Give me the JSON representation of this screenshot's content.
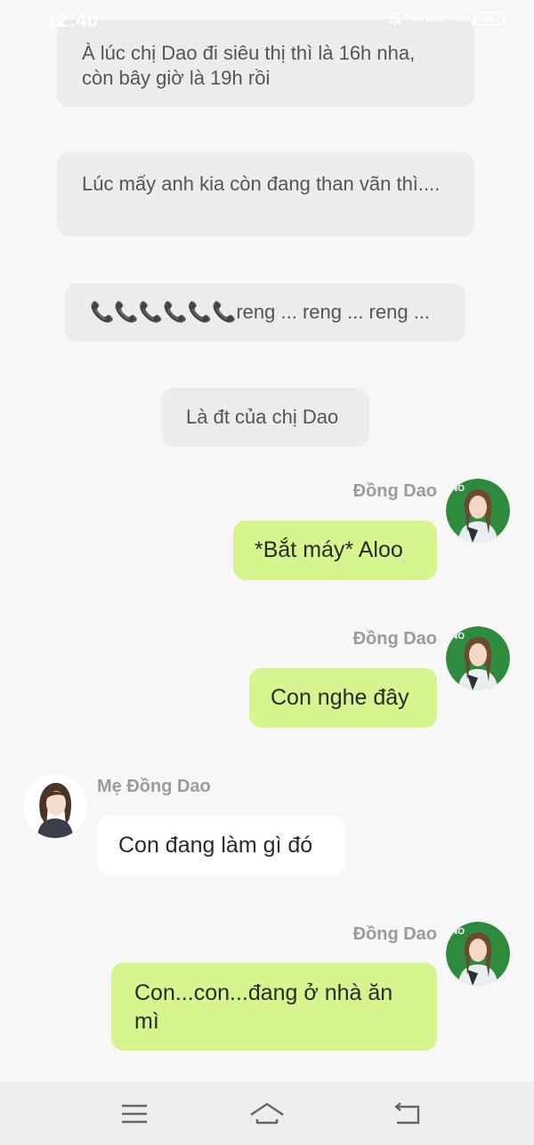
{
  "status_bar": {
    "time": "12:40",
    "signal_text": "4G",
    "net_speed": "3.4 KB/S",
    "net_type": "4G",
    "battery": "58",
    "icons": [
      "signal-icon",
      "mute-bell-icon",
      "battery-icon"
    ]
  },
  "narration": [
    "À lúc chị Dao đi siêu thị thì là 16h nha, còn bây giờ là 19h rồi",
    "Lúc mấy anh kia còn đang than vãn thì....",
    "📞📞📞📞📞📞reng ... reng ... reng ...",
    "Là đt của chị Dao"
  ],
  "messages": [
    {
      "sender": "Đồng Dao",
      "side": "right",
      "text": "*Bắt máy* Aloo"
    },
    {
      "sender": "Đồng Dao",
      "side": "right",
      "text": "Con nghe đây"
    },
    {
      "sender": "Mẹ Đồng Dao",
      "side": "left",
      "text": "Con đang làm gì đó"
    },
    {
      "sender": "Đồng Dao",
      "side": "right",
      "text": "Con...con...đang ở nhà ăn mì"
    }
  ],
  "colors": {
    "background": "#f7f7f7",
    "narration_bg": "#ececec",
    "green_bubble": "#d6f58f",
    "white_bubble": "#ffffff",
    "name_text": "#9b9b9b",
    "avatar_ring": "#2e8b3e"
  },
  "nav": {
    "icons": [
      "menu-icon",
      "home-icon",
      "back-icon"
    ]
  }
}
